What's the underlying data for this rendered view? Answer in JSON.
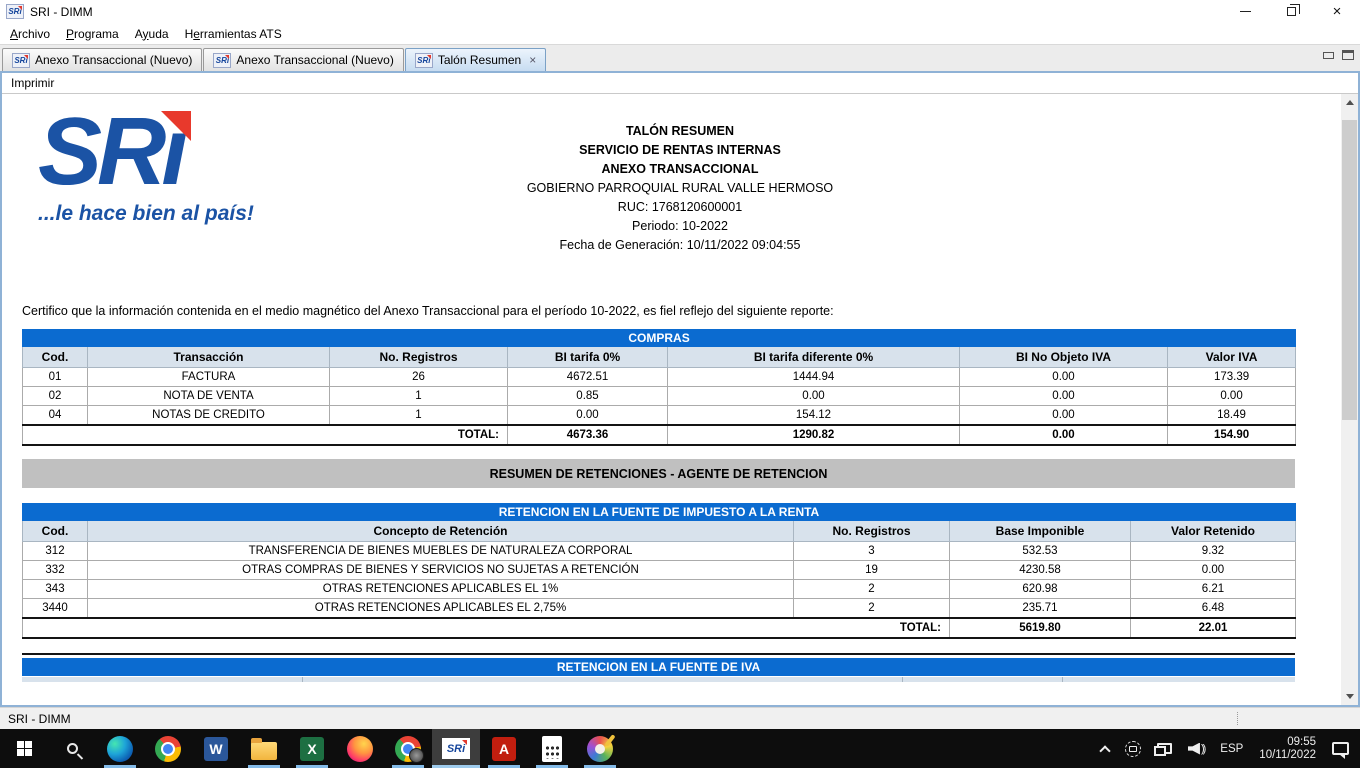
{
  "window": {
    "title": "SRI - DIMM"
  },
  "menu_bar": {
    "items": [
      {
        "label": "Archivo",
        "u": 0
      },
      {
        "label": "Programa",
        "u": 0
      },
      {
        "label": "Ayuda",
        "u": 1
      },
      {
        "label": "Herramientas ATS",
        "u": 1
      }
    ]
  },
  "tab_bar": {
    "tabs": [
      {
        "label": "Anexo Transaccional (Nuevo)"
      },
      {
        "label": "Anexo Transaccional (Nuevo)"
      },
      {
        "label": "Talón Resumen"
      }
    ],
    "close_glyph": "×"
  },
  "toolbar": {
    "imprimir_label": "Imprimir"
  },
  "logo": {
    "main": "SR",
    "i_body": "ı",
    "tagline": "...le hace bien al país!"
  },
  "report": {
    "title_lines": [
      "TALÓN RESUMEN",
      "SERVICIO DE RENTAS INTERNAS",
      "ANEXO TRANSACCIONAL"
    ],
    "info_lines": [
      "GOBIERNO PARROQUIAL RURAL VALLE HERMOSO",
      "RUC: 1768120600001",
      "Periodo: 10-2022",
      "Fecha de Generación: 10/11/2022 09:04:55"
    ],
    "certification": "Certifico que la información contenida en el medio magnético del Anexo Transaccional para el período 10-2022, es fiel reflejo del siguiente reporte:"
  },
  "compras": {
    "band": "COMPRAS",
    "headers": [
      "Cod.",
      "Transacción",
      "No. Registros",
      "BI tarifa 0%",
      "BI tarifa diferente 0%",
      "BI No Objeto IVA",
      "Valor IVA"
    ],
    "rows": [
      [
        "01",
        "FACTURA",
        "26",
        "4672.51",
        "1444.94",
        "0.00",
        "173.39"
      ],
      [
        "02",
        "NOTA DE VENTA",
        "1",
        "0.85",
        "0.00",
        "0.00",
        "0.00"
      ],
      [
        "04",
        "NOTAS DE CREDITO",
        "1",
        "0.00",
        "154.12",
        "0.00",
        "18.49"
      ]
    ],
    "total_label": "TOTAL:",
    "totals": [
      "4673.36",
      "1290.82",
      "0.00",
      "154.90"
    ]
  },
  "summary_band": "RESUMEN DE RETENCIONES - AGENTE DE RETENCION",
  "renta": {
    "band": "RETENCION EN LA FUENTE DE IMPUESTO A LA RENTA",
    "headers": [
      "Cod.",
      "Concepto de Retención",
      "No. Registros",
      "Base Imponible",
      "Valor Retenido"
    ],
    "rows": [
      [
        "312",
        "TRANSFERENCIA DE BIENES MUEBLES DE NATURALEZA CORPORAL",
        "3",
        "532.53",
        "9.32"
      ],
      [
        "332",
        "OTRAS COMPRAS DE BIENES Y SERVICIOS NO SUJETAS A RETENCIÓN",
        "19",
        "4230.58",
        "0.00"
      ],
      [
        "343",
        "OTRAS RETENCIONES APLICABLES EL 1%",
        "2",
        "620.98",
        "6.21"
      ],
      [
        "3440",
        "OTRAS RETENCIONES APLICABLES EL 2,75%",
        "2",
        "235.71",
        "6.48"
      ]
    ],
    "total_label": "TOTAL:",
    "totals": [
      "5619.80",
      "22.01"
    ]
  },
  "iva": {
    "band": "RETENCION EN LA FUENTE DE IVA"
  },
  "status_bar": {
    "text": "SRI - DIMM"
  },
  "taskbar": {
    "glyphs": {
      "word": "W",
      "excel": "X",
      "sri": "SRi",
      "acrobat": "A"
    },
    "tray": {
      "language": "ESP",
      "time": "09:55",
      "date": "10/11/2022"
    }
  },
  "colors": {
    "band_blue": "#0b6bd0",
    "header_bg": "#d8e2ec",
    "gray_band": "#c0c0c0",
    "logo_blue": "#1b53a5",
    "logo_red": "#e8392c"
  }
}
